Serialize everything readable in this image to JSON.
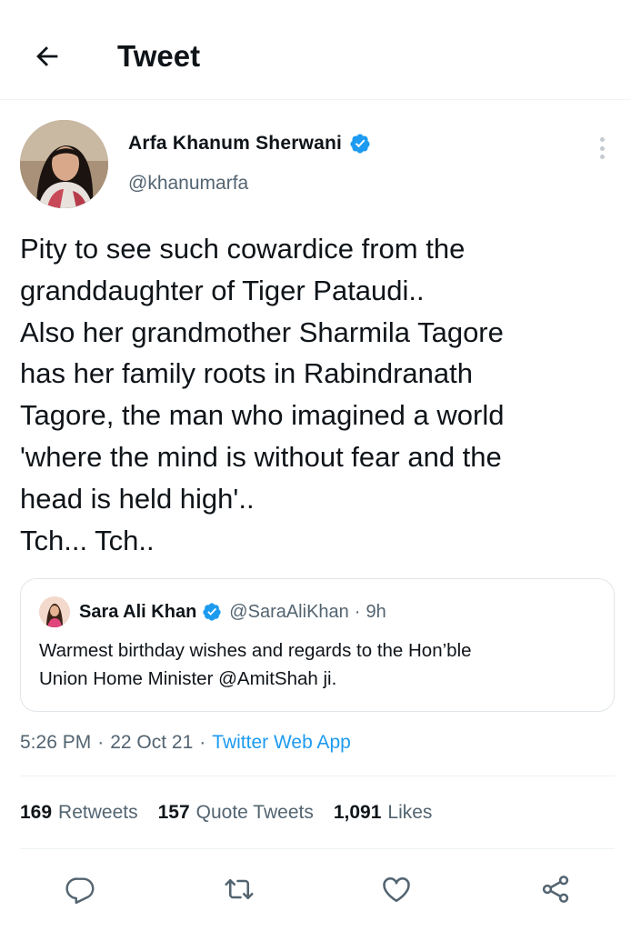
{
  "header": {
    "title": "Tweet",
    "back_icon": "arrow-left-icon"
  },
  "author": {
    "name": "Arfa Khanum Sherwani",
    "handle": "@khanumarfa",
    "verified_icon": "verified-badge-icon",
    "more_icon": "more-vertical-icon"
  },
  "tweet": {
    "lines": [
      "Pity to see such cowardice from the",
      "granddaughter of Tiger Pataudi..",
      "Also her grandmother Sharmila Tagore",
      "has her family roots in Rabindranath",
      "Tagore, the man who imagined a world",
      "'where the mind is without fear and the",
      "head is held high'..",
      "Tch... Tch.."
    ]
  },
  "quote": {
    "name": "Sara Ali Khan",
    "handle": "@SaraAliKhan",
    "separator": "·",
    "time": "9h",
    "lines": [
      "Warmest birthday wishes and regards to the Hon’ble",
      "Union Home Minister @AmitShah ji."
    ]
  },
  "meta": {
    "time": "5:26 PM",
    "dot1": "·",
    "date": "22 Oct 21",
    "dot2": "·",
    "source": "Twitter Web App"
  },
  "stats": {
    "retweets_count": "169",
    "retweets_label": "Retweets",
    "quotes_count": "157",
    "quotes_label": "Quote Tweets",
    "likes_count": "1,091",
    "likes_label": "Likes"
  },
  "actions": [
    "reply-icon",
    "retweet-icon",
    "like-icon",
    "share-icon"
  ],
  "colors": {
    "accent": "#1d9bf0",
    "text": "#0f1419",
    "secondary_text": "#536471",
    "icon": "#536471",
    "border": "#e1e6ea"
  }
}
